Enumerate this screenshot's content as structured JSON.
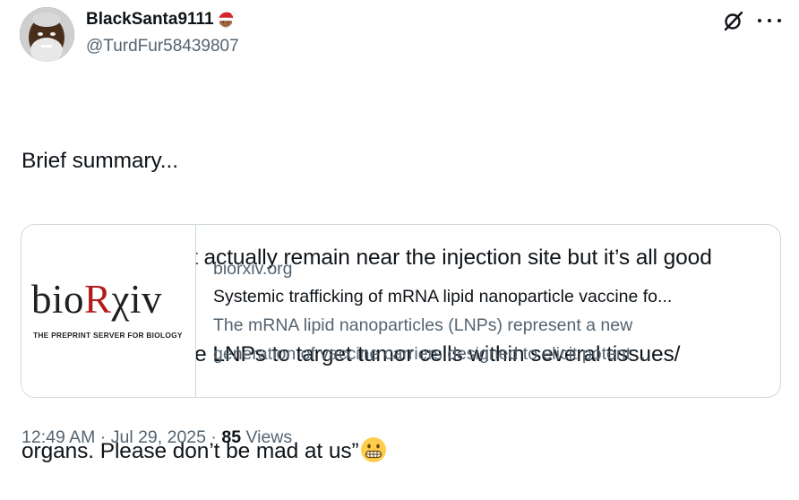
{
  "author": {
    "display_name": "BlackSanta9111",
    "handle": "@TurdFur58439807",
    "badge_emoji": "santa-emoji"
  },
  "header_actions": {
    "grok_icon": "grok-icon",
    "more_icon": "more-icon"
  },
  "tweet": {
    "lines": [
      "Brief summary...",
      "“Ok fine. It doesn’t actually remain near the injection site but it’s all good",
      "bc we can now use LNPs to target tumor cells within several tissues/",
      "organs. Please don’t be mad at us”"
    ],
    "trailing_emoji": "grimacing-face-emoji"
  },
  "link_card": {
    "logo_text_bio": "bio",
    "logo_text_r": "R",
    "logo_text_xiv": "χiv",
    "logo_tagline": "THE PREPRINT SERVER FOR BIOLOGY",
    "domain": "biorxiv.org",
    "title": "Systemic trafficking of mRNA lipid nanoparticle vaccine fo...",
    "description_line1": "The mRNA lipid nanoparticles (LNPs) represent a new",
    "description_line2": "generation of vaccine carriers designed to elicit potent ..."
  },
  "meta": {
    "time": "12:49 AM",
    "separator1": " · ",
    "date": "Jul 29, 2025",
    "separator2": " · ",
    "view_count": "85",
    "views_label": " Views"
  },
  "colors": {
    "text_primary": "#0f1419",
    "text_secondary": "#536471",
    "border": "#cfd9de",
    "biorxiv_red": "#b31b1b"
  }
}
